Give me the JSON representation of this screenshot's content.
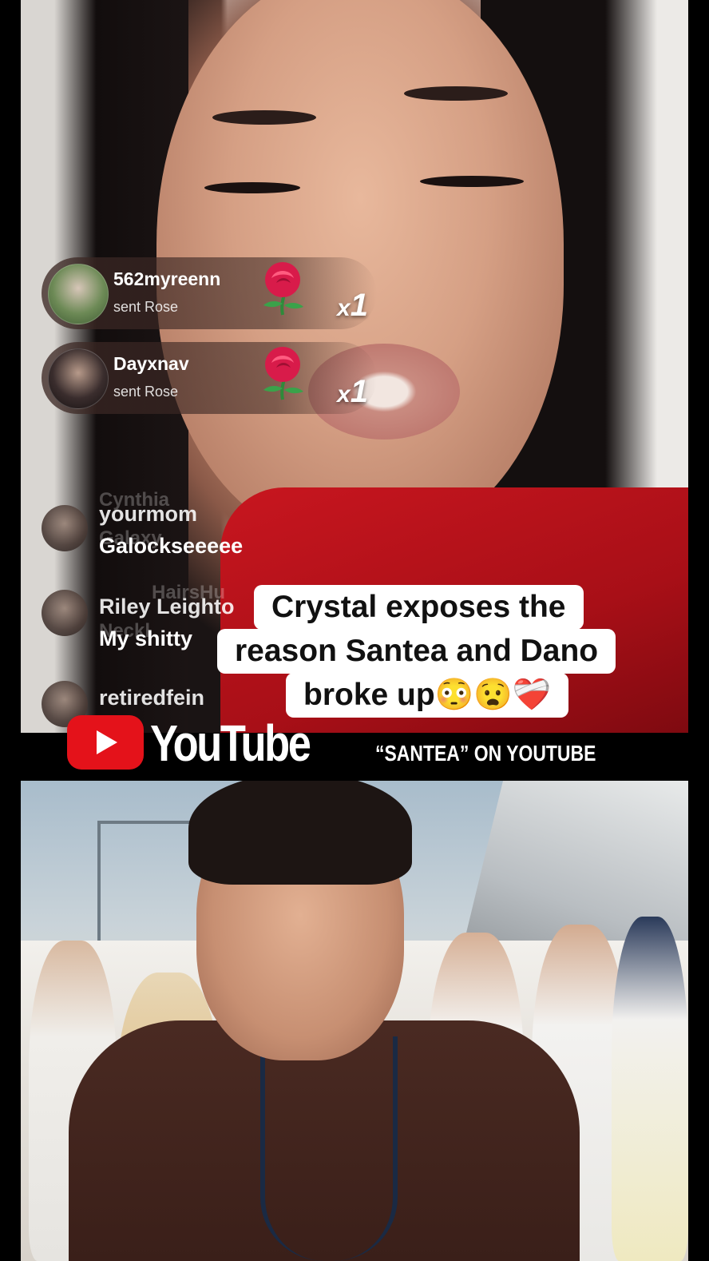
{
  "live": {
    "gifts": [
      {
        "user": "562myreenn",
        "action": "sent Rose",
        "count_prefix": "x",
        "count": "1"
      },
      {
        "user": "Dayxnav",
        "action": "sent Rose",
        "count_prefix": "x",
        "count": "1"
      }
    ],
    "ghost_joins": [
      "Cynthia",
      "Galaxy",
      "HairsHu",
      "Neckl"
    ],
    "chat": [
      {
        "user": "yourmom",
        "message": "Galockseeeee"
      },
      {
        "user": "Riley Leighto",
        "message": "My shitty"
      },
      {
        "user": "retiredfein",
        "message": ""
      }
    ]
  },
  "caption": {
    "line1": "Crystal exposes the",
    "line2": "reason Santea and Dano",
    "line3": "broke up😳😧❤️‍🩹"
  },
  "youtube_bar": {
    "wordmark": "YouTube",
    "tag": "“SANTEA” ON YOUTUBE"
  },
  "colors": {
    "youtube_red": "#e4121a",
    "shirt_red": "#c8161f",
    "caption_bg": "#ffffff"
  }
}
